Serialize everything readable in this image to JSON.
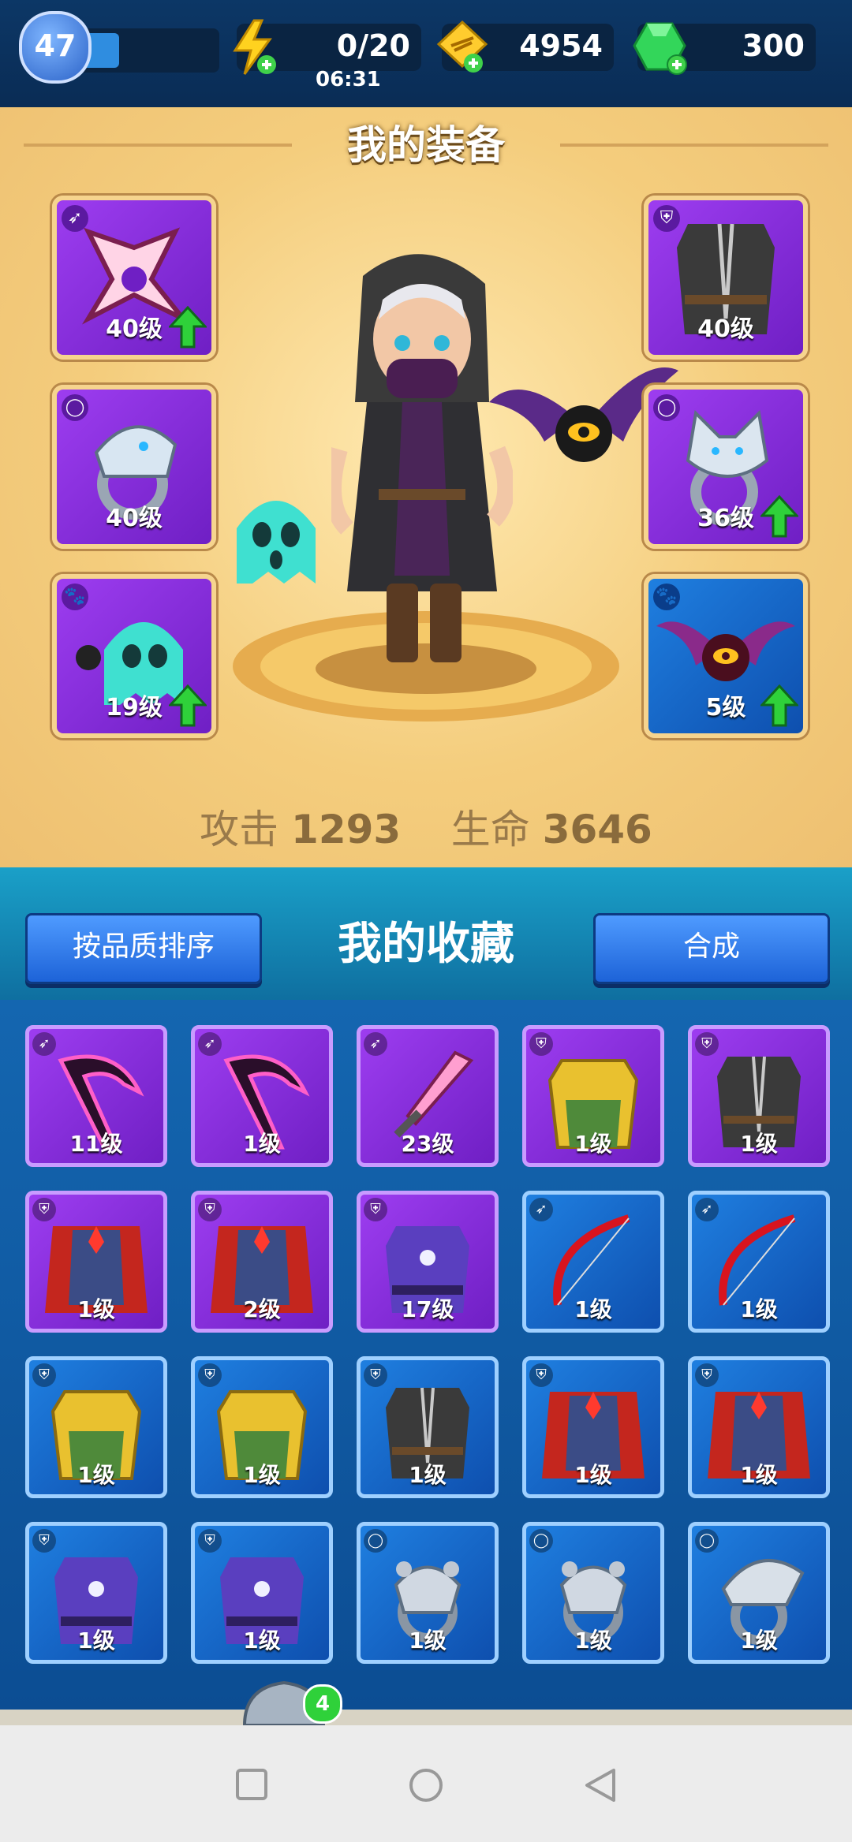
{
  "hud": {
    "player_level": "47",
    "xp_fraction": 0.3,
    "energy": "0/20",
    "energy_timer": "06:31",
    "gold": "4954",
    "gems": "300"
  },
  "equipment": {
    "title": "我的装备",
    "left_slots": [
      {
        "level": "40级",
        "category_icon": "weapon-icon",
        "item": "shuriken-icon",
        "upgrade": true,
        "rarity": "purple"
      },
      {
        "level": "40级",
        "category_icon": "ring-icon",
        "item": "serpent-ring-icon",
        "upgrade": false,
        "rarity": "purple"
      },
      {
        "level": "19级",
        "category_icon": "pet-icon",
        "item": "ghost-pet-icon",
        "upgrade": true,
        "rarity": "purple"
      }
    ],
    "right_slots": [
      {
        "level": "40级",
        "category_icon": "armor-icon",
        "item": "dark-armor-icon",
        "upgrade": false,
        "rarity": "purple"
      },
      {
        "level": "36级",
        "category_icon": "ring-icon",
        "item": "wolf-ring-icon",
        "upgrade": true,
        "rarity": "purple"
      },
      {
        "level": "5级",
        "category_icon": "pet-icon",
        "item": "bat-pet-icon",
        "upgrade": true,
        "rarity": "blue"
      }
    ],
    "stats": {
      "attack_label": "攻击",
      "attack_value": "1293",
      "hp_label": "生命",
      "hp_value": "3646"
    }
  },
  "collection": {
    "title": "我的收藏",
    "sort_button": "按品质排序",
    "merge_button": "合成",
    "items": [
      {
        "level": "11级",
        "rarity": "purple",
        "icon": "scythe-icon"
      },
      {
        "level": "1级",
        "rarity": "purple",
        "icon": "scythe-icon"
      },
      {
        "level": "23级",
        "rarity": "purple",
        "icon": "sword-icon"
      },
      {
        "level": "1级",
        "rarity": "purple",
        "icon": "gold-armor-icon"
      },
      {
        "level": "1级",
        "rarity": "purple",
        "icon": "dark-armor-icon"
      },
      {
        "level": "1级",
        "rarity": "purple",
        "icon": "red-cape-armor-icon"
      },
      {
        "level": "2级",
        "rarity": "purple",
        "icon": "red-cape-armor-icon"
      },
      {
        "level": "17级",
        "rarity": "purple",
        "icon": "mage-robe-icon"
      },
      {
        "level": "1级",
        "rarity": "blue",
        "icon": "bow-icon"
      },
      {
        "level": "1级",
        "rarity": "blue",
        "icon": "bow-icon"
      },
      {
        "level": "1级",
        "rarity": "blue",
        "icon": "gold-armor-icon"
      },
      {
        "level": "1级",
        "rarity": "blue",
        "icon": "gold-armor-icon"
      },
      {
        "level": "1级",
        "rarity": "blue",
        "icon": "dark-armor-icon"
      },
      {
        "level": "1级",
        "rarity": "blue",
        "icon": "red-cape-armor-icon"
      },
      {
        "level": "1级",
        "rarity": "blue",
        "icon": "red-cape-armor-icon"
      },
      {
        "level": "1级",
        "rarity": "blue",
        "icon": "mage-robe-icon"
      },
      {
        "level": "1级",
        "rarity": "blue",
        "icon": "mage-robe-icon"
      },
      {
        "level": "1级",
        "rarity": "blue",
        "icon": "bear-ring-icon"
      },
      {
        "level": "1级",
        "rarity": "blue",
        "icon": "bear-ring-icon"
      },
      {
        "level": "1级",
        "rarity": "blue",
        "icon": "eagle-ring-icon"
      }
    ]
  },
  "nav_badge": "4",
  "colors": {
    "purple": "#8a2fe0",
    "blue": "#1768cc",
    "gold_panel": "#f4cd7d",
    "upgrade_arrow": "#2fd13a"
  }
}
